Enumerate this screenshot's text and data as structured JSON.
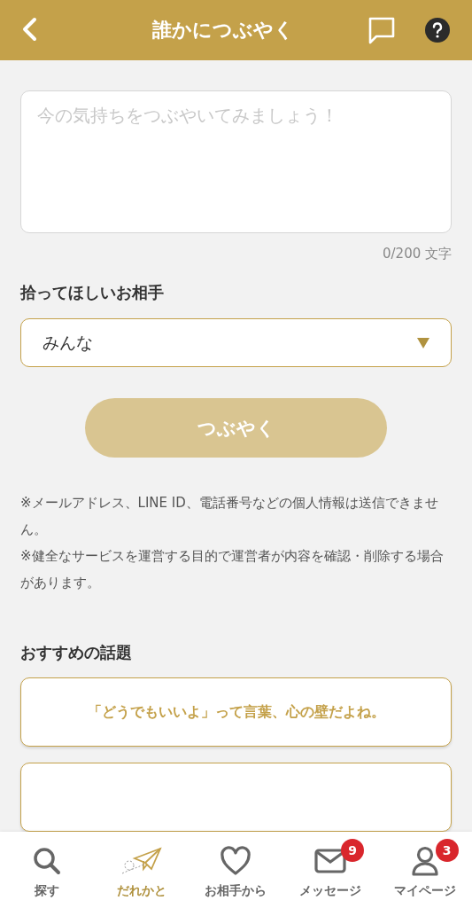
{
  "header": {
    "title": "誰かにつぶやく"
  },
  "compose": {
    "placeholder": "今の気持ちをつぶやいてみましょう！",
    "counter": "0/200 文字"
  },
  "recipient": {
    "label": "拾ってほしいお相手",
    "value": "みんな"
  },
  "submit": {
    "label": "つぶやく",
    "disabled": true
  },
  "notes": [
    "※メールアドレス、LINE ID、電話番号などの個人情報は送信できません。",
    "※健全なサービスを運営する目的で運営者が内容を確認・削除する場合があります。"
  ],
  "topics": {
    "heading": "おすすめの話題",
    "items": [
      "「どうでもいいよ」って言葉、心の壁だよね。"
    ]
  },
  "nav": [
    {
      "kind": "search",
      "label": "探す",
      "selected": false
    },
    {
      "kind": "plane",
      "label": "だれかと",
      "selected": true
    },
    {
      "kind": "heart",
      "label": "お相手から",
      "selected": false
    },
    {
      "kind": "mail",
      "label": "メッセージ",
      "selected": false,
      "badge": "9"
    },
    {
      "kind": "person",
      "label": "マイページ",
      "selected": false,
      "badge": "3"
    }
  ]
}
